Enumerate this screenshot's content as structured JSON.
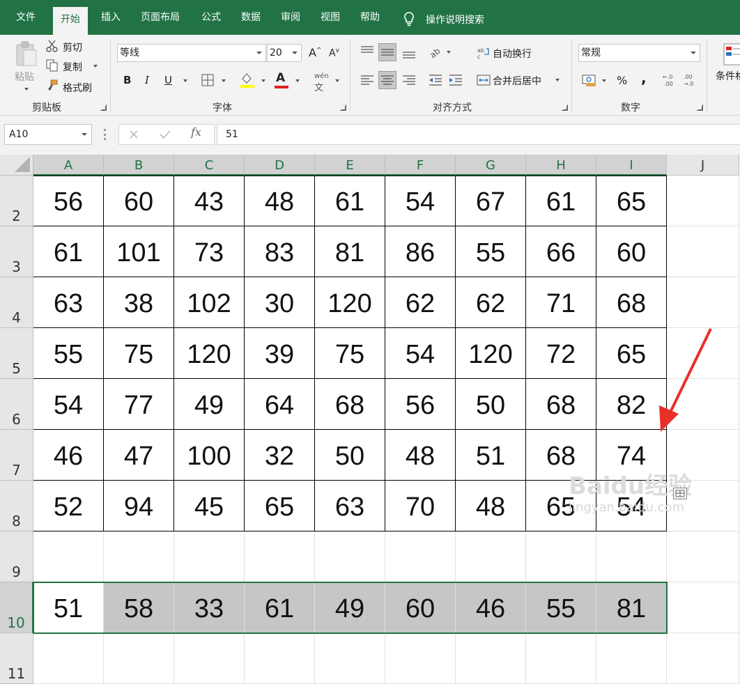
{
  "tabs": [
    "文件",
    "开始",
    "插入",
    "页面布局",
    "公式",
    "数据",
    "审阅",
    "视图",
    "帮助"
  ],
  "active_tab": "开始",
  "tell_me": "操作说明搜索",
  "clipboard": {
    "paste": "粘贴",
    "cut": "剪切",
    "copy": "复制",
    "format_painter": "格式刷",
    "label": "剪贴板"
  },
  "font": {
    "name": "等线",
    "size": "20",
    "label": "字体"
  },
  "alignment": {
    "wrap_text": "自动换行",
    "merge_center": "合并后居中",
    "label": "对齐方式"
  },
  "number": {
    "format": "常规",
    "label": "数字",
    "percent": "%",
    "comma": ","
  },
  "styles": {
    "conditional_format": "条件格"
  },
  "name_box": "A10",
  "formula_value": "51",
  "columns": [
    "A",
    "B",
    "C",
    "D",
    "E",
    "F",
    "G",
    "H",
    "I",
    "J"
  ],
  "rows": [
    {
      "num": "2",
      "cells": [
        "56",
        "60",
        "43",
        "48",
        "61",
        "54",
        "67",
        "61",
        "65"
      ]
    },
    {
      "num": "3",
      "cells": [
        "61",
        "101",
        "73",
        "83",
        "81",
        "86",
        "55",
        "66",
        "60"
      ]
    },
    {
      "num": "4",
      "cells": [
        "63",
        "38",
        "102",
        "30",
        "120",
        "62",
        "62",
        "71",
        "68"
      ]
    },
    {
      "num": "5",
      "cells": [
        "55",
        "75",
        "120",
        "39",
        "75",
        "54",
        "120",
        "72",
        "65"
      ]
    },
    {
      "num": "6",
      "cells": [
        "54",
        "77",
        "49",
        "64",
        "68",
        "56",
        "50",
        "68",
        "82"
      ]
    },
    {
      "num": "7",
      "cells": [
        "46",
        "47",
        "100",
        "32",
        "50",
        "48",
        "51",
        "68",
        "74"
      ]
    },
    {
      "num": "8",
      "cells": [
        "52",
        "94",
        "45",
        "65",
        "63",
        "70",
        "48",
        "65",
        "54"
      ]
    },
    {
      "num": "9",
      "cells": [
        "",
        "",
        "",
        "",
        "",
        "",
        "",
        "",
        ""
      ]
    },
    {
      "num": "10",
      "cells": [
        "51",
        "58",
        "33",
        "61",
        "49",
        "60",
        "46",
        "55",
        "81"
      ]
    },
    {
      "num": "11",
      "cells": [
        "",
        "",
        "",
        "",
        "",
        "",
        "",
        "",
        ""
      ]
    }
  ],
  "selected_row": "10",
  "watermark": {
    "brand": "Baidu经验",
    "url": "jingyan.baidu.com"
  },
  "colors": {
    "excel_green": "#217346",
    "arrow_red": "#e8302a",
    "selection_fill": "#c6c6c6"
  }
}
